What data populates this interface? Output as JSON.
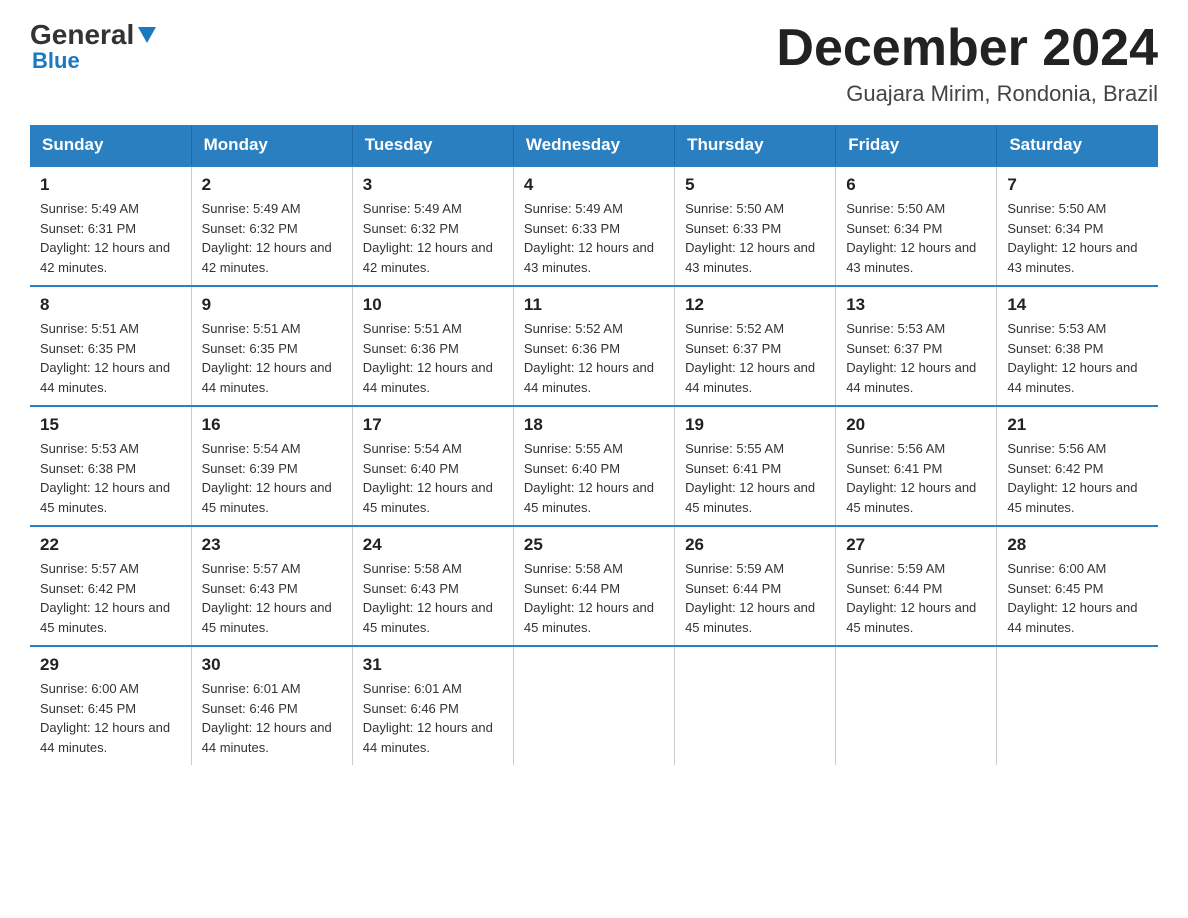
{
  "header": {
    "logo_general": "General",
    "logo_blue": "Blue",
    "title": "December 2024",
    "subtitle": "Guajara Mirim, Rondonia, Brazil"
  },
  "days_of_week": [
    "Sunday",
    "Monday",
    "Tuesday",
    "Wednesday",
    "Thursday",
    "Friday",
    "Saturday"
  ],
  "weeks": [
    [
      {
        "day": "1",
        "sunrise": "5:49 AM",
        "sunset": "6:31 PM",
        "daylight": "12 hours and 42 minutes."
      },
      {
        "day": "2",
        "sunrise": "5:49 AM",
        "sunset": "6:32 PM",
        "daylight": "12 hours and 42 minutes."
      },
      {
        "day": "3",
        "sunrise": "5:49 AM",
        "sunset": "6:32 PM",
        "daylight": "12 hours and 42 minutes."
      },
      {
        "day": "4",
        "sunrise": "5:49 AM",
        "sunset": "6:33 PM",
        "daylight": "12 hours and 43 minutes."
      },
      {
        "day": "5",
        "sunrise": "5:50 AM",
        "sunset": "6:33 PM",
        "daylight": "12 hours and 43 minutes."
      },
      {
        "day": "6",
        "sunrise": "5:50 AM",
        "sunset": "6:34 PM",
        "daylight": "12 hours and 43 minutes."
      },
      {
        "day": "7",
        "sunrise": "5:50 AM",
        "sunset": "6:34 PM",
        "daylight": "12 hours and 43 minutes."
      }
    ],
    [
      {
        "day": "8",
        "sunrise": "5:51 AM",
        "sunset": "6:35 PM",
        "daylight": "12 hours and 44 minutes."
      },
      {
        "day": "9",
        "sunrise": "5:51 AM",
        "sunset": "6:35 PM",
        "daylight": "12 hours and 44 minutes."
      },
      {
        "day": "10",
        "sunrise": "5:51 AM",
        "sunset": "6:36 PM",
        "daylight": "12 hours and 44 minutes."
      },
      {
        "day": "11",
        "sunrise": "5:52 AM",
        "sunset": "6:36 PM",
        "daylight": "12 hours and 44 minutes."
      },
      {
        "day": "12",
        "sunrise": "5:52 AM",
        "sunset": "6:37 PM",
        "daylight": "12 hours and 44 minutes."
      },
      {
        "day": "13",
        "sunrise": "5:53 AM",
        "sunset": "6:37 PM",
        "daylight": "12 hours and 44 minutes."
      },
      {
        "day": "14",
        "sunrise": "5:53 AM",
        "sunset": "6:38 PM",
        "daylight": "12 hours and 44 minutes."
      }
    ],
    [
      {
        "day": "15",
        "sunrise": "5:53 AM",
        "sunset": "6:38 PM",
        "daylight": "12 hours and 45 minutes."
      },
      {
        "day": "16",
        "sunrise": "5:54 AM",
        "sunset": "6:39 PM",
        "daylight": "12 hours and 45 minutes."
      },
      {
        "day": "17",
        "sunrise": "5:54 AM",
        "sunset": "6:40 PM",
        "daylight": "12 hours and 45 minutes."
      },
      {
        "day": "18",
        "sunrise": "5:55 AM",
        "sunset": "6:40 PM",
        "daylight": "12 hours and 45 minutes."
      },
      {
        "day": "19",
        "sunrise": "5:55 AM",
        "sunset": "6:41 PM",
        "daylight": "12 hours and 45 minutes."
      },
      {
        "day": "20",
        "sunrise": "5:56 AM",
        "sunset": "6:41 PM",
        "daylight": "12 hours and 45 minutes."
      },
      {
        "day": "21",
        "sunrise": "5:56 AM",
        "sunset": "6:42 PM",
        "daylight": "12 hours and 45 minutes."
      }
    ],
    [
      {
        "day": "22",
        "sunrise": "5:57 AM",
        "sunset": "6:42 PM",
        "daylight": "12 hours and 45 minutes."
      },
      {
        "day": "23",
        "sunrise": "5:57 AM",
        "sunset": "6:43 PM",
        "daylight": "12 hours and 45 minutes."
      },
      {
        "day": "24",
        "sunrise": "5:58 AM",
        "sunset": "6:43 PM",
        "daylight": "12 hours and 45 minutes."
      },
      {
        "day": "25",
        "sunrise": "5:58 AM",
        "sunset": "6:44 PM",
        "daylight": "12 hours and 45 minutes."
      },
      {
        "day": "26",
        "sunrise": "5:59 AM",
        "sunset": "6:44 PM",
        "daylight": "12 hours and 45 minutes."
      },
      {
        "day": "27",
        "sunrise": "5:59 AM",
        "sunset": "6:44 PM",
        "daylight": "12 hours and 45 minutes."
      },
      {
        "day": "28",
        "sunrise": "6:00 AM",
        "sunset": "6:45 PM",
        "daylight": "12 hours and 44 minutes."
      }
    ],
    [
      {
        "day": "29",
        "sunrise": "6:00 AM",
        "sunset": "6:45 PM",
        "daylight": "12 hours and 44 minutes."
      },
      {
        "day": "30",
        "sunrise": "6:01 AM",
        "sunset": "6:46 PM",
        "daylight": "12 hours and 44 minutes."
      },
      {
        "day": "31",
        "sunrise": "6:01 AM",
        "sunset": "6:46 PM",
        "daylight": "12 hours and 44 minutes."
      },
      null,
      null,
      null,
      null
    ]
  ]
}
